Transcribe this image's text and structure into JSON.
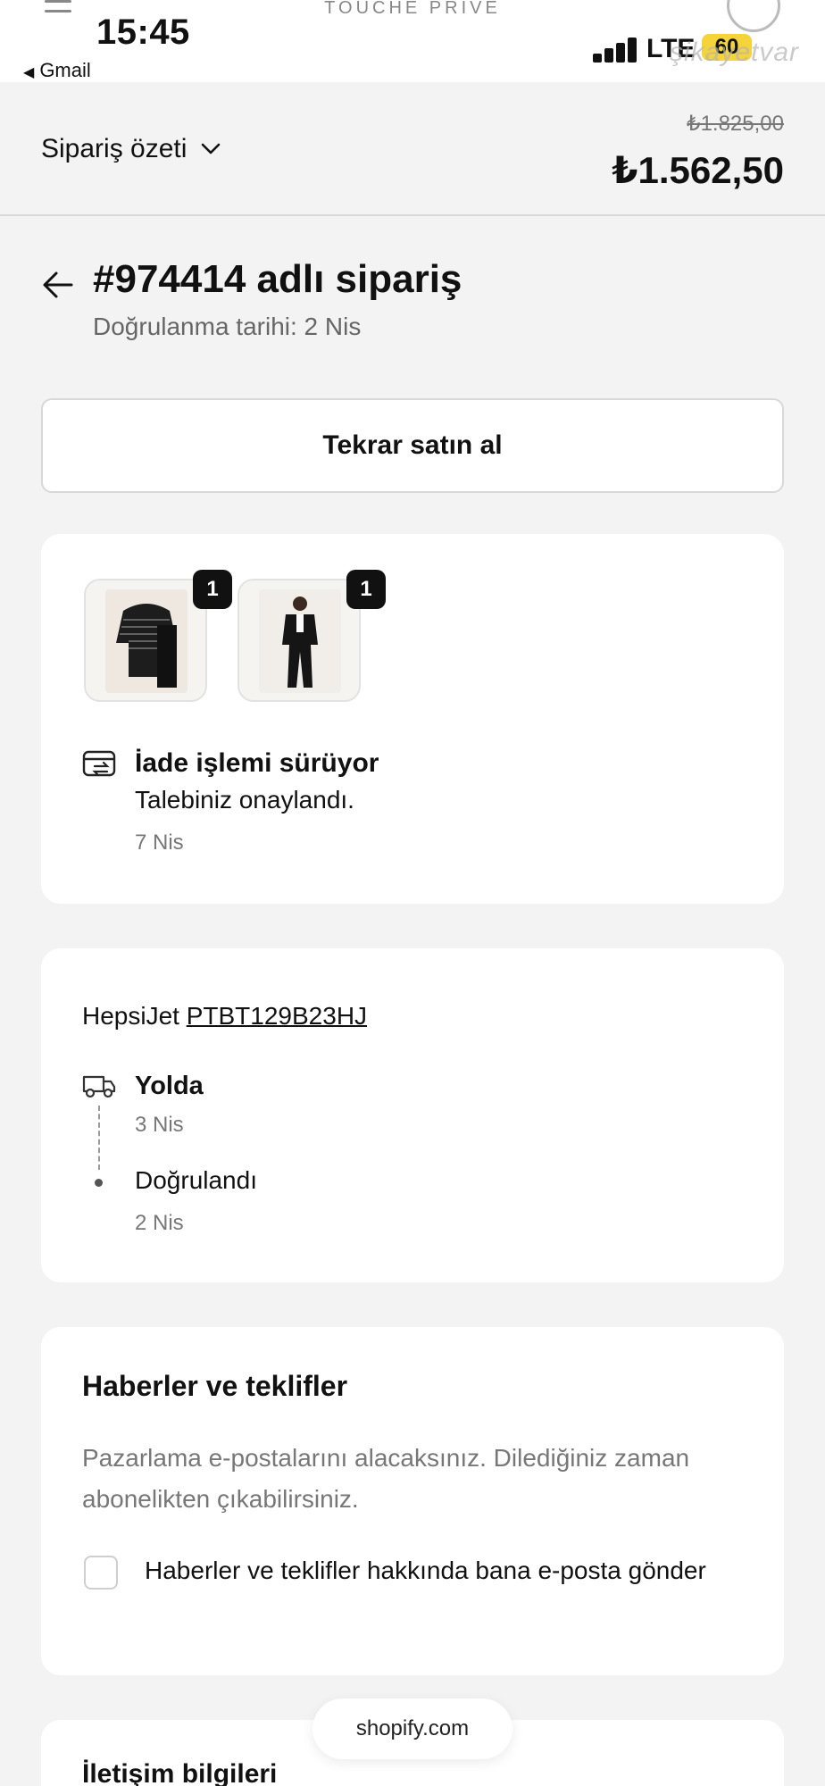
{
  "status_bar": {
    "time": "15:45",
    "back_app": "Gmail",
    "brand": "TOUCHE PRIVE",
    "network": "LTE",
    "battery": "60",
    "watermark": "şikayetvar"
  },
  "summary": {
    "toggle_label": "Sipariş özeti",
    "old_price": "₺1.825,00",
    "total": "₺1.562,50"
  },
  "order": {
    "title": "#974414 adlı sipariş",
    "confirmed_date": "Doğrulanma tarihi: 2 Nis"
  },
  "buy_again_label": "Tekrar satın al",
  "return_card": {
    "items": [
      {
        "quantity": "1",
        "image": "sweater-and-dress"
      },
      {
        "quantity": "1",
        "image": "black-suit"
      }
    ],
    "status_title": "İade işlemi sürüyor",
    "status_message": "Talebiniz onaylandı.",
    "status_date": "7 Nis"
  },
  "shipment_card": {
    "carrier": "HepsiJet",
    "tracking_number": "PTBT129B23HJ",
    "timeline": [
      {
        "label": "Yolda",
        "date": "3 Nis"
      },
      {
        "label": "Doğrulandı",
        "date": "2 Nis"
      }
    ]
  },
  "news_card": {
    "title": "Haberler ve teklifler",
    "description": "Pazarlama e-postalarını alacaksınız. Dilediğiniz zaman abonelikten çıkabilirsiniz.",
    "checkbox_label": "Haberler ve teklifler hakkında bana e-posta gönder",
    "checked": false
  },
  "contact_card": {
    "title": "İletişim bilgileri"
  },
  "footer_pill": "shopify.com",
  "colors": {
    "background": "#f3f3f3",
    "card": "#ffffff",
    "badge": "#111111",
    "battery": "#f5d33a"
  }
}
